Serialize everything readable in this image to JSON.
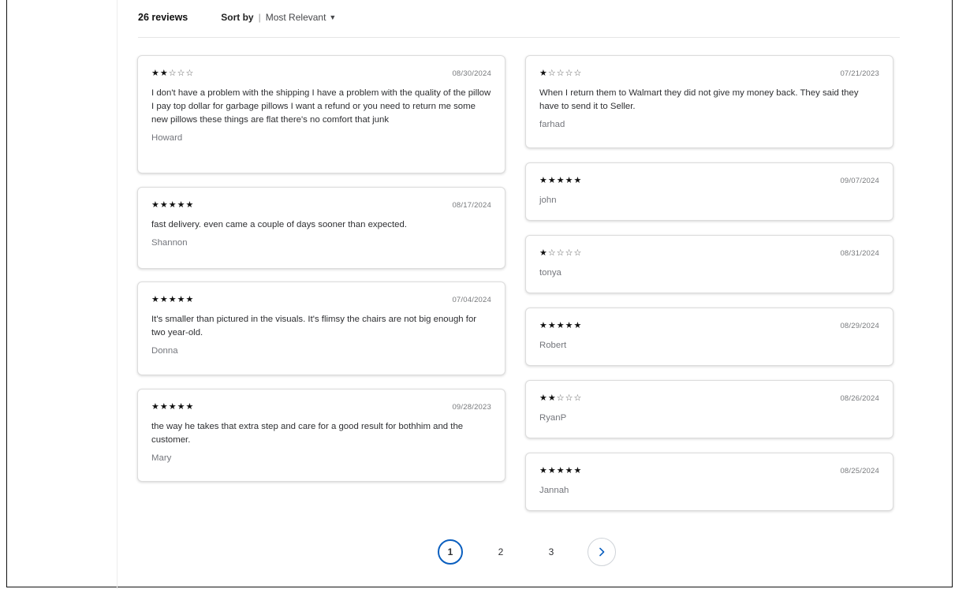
{
  "header": {
    "review_count": "26 reviews",
    "sort_label": "Sort by",
    "sort_separator": "|",
    "sort_value": "Most Relevant"
  },
  "reviews_left": [
    {
      "rating": 2,
      "date": "08/30/2024",
      "text": "I don't have a problem with the shipping I have a problem with the quality of the pillow I pay top dollar for garbage pillows I want a refund or you need to return me some new pillows these things are flat there's no comfort that junk",
      "author": "Howard"
    },
    {
      "rating": 5,
      "date": "08/17/2024",
      "text": "fast delivery. even came a couple of days sooner than expected.",
      "author": "Shannon"
    },
    {
      "rating": 5,
      "date": "07/04/2024",
      "text": "It's smaller than pictured in the visuals. It's flimsy the chairs are not big enough for two year-old.",
      "author": "Donna"
    },
    {
      "rating": 5,
      "date": "09/28/2023",
      "text": "the way he takes that extra step and care for a good result for bothhim and the customer.",
      "author": "Mary"
    }
  ],
  "reviews_right": [
    {
      "rating": 1,
      "date": "07/21/2023",
      "text": "When I return them to Walmart they did not give my money back. They said they have to send it to Seller.",
      "author": "farhad"
    },
    {
      "rating": 5,
      "date": "09/07/2024",
      "text": "",
      "author": "john"
    },
    {
      "rating": 1,
      "date": "08/31/2024",
      "text": "",
      "author": "tonya"
    },
    {
      "rating": 5,
      "date": "08/29/2024",
      "text": "",
      "author": "Robert"
    },
    {
      "rating": 2,
      "date": "08/26/2024",
      "text": "",
      "author": "RyanP"
    },
    {
      "rating": 5,
      "date": "08/25/2024",
      "text": "",
      "author": "Jannah"
    }
  ],
  "pagination": {
    "pages": [
      "1",
      "2",
      "3"
    ],
    "current": "1",
    "next_icon": "chevron-right-icon"
  },
  "colors": {
    "accent": "#0b5fbf",
    "star": "#111111",
    "muted_text": "#74767c",
    "card_border": "#dcdcdc"
  }
}
